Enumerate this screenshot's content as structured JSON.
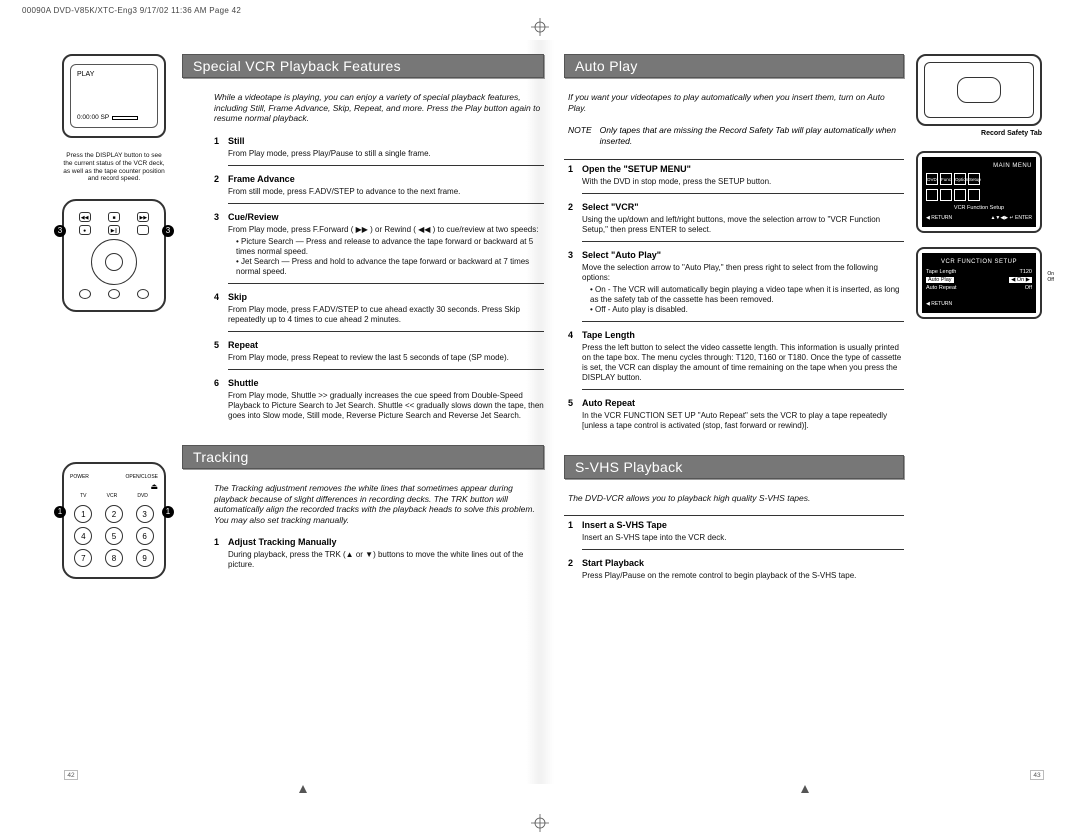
{
  "header_line": "00090A DVD-V85K/XTC-Eng3  9/17/02 11:36 AM  Page 42",
  "page_numbers": {
    "left": "42",
    "right": "43"
  },
  "left_page": {
    "sections": [
      {
        "title": "Special VCR Playback Features",
        "intro": "While a videotape is playing, you can enjoy a variety of special playback features, including Still, Frame Advance, Skip, Repeat, and more. Press the Play button again to resume normal playback.",
        "sidebar": {
          "tv_play_label": "PLAY",
          "tv_counter": "0:00:00 SP",
          "tv_caption": "Press the DISPLAY button to see the current status of the VCR deck, as well as the tape counter position and record speed."
        },
        "steps": [
          {
            "n": "1",
            "title": "Still",
            "text": "From Play mode, press Play/Pause to still a single frame."
          },
          {
            "n": "2",
            "title": "Frame Advance",
            "text": "From still mode, press F.ADV/STEP to advance to the next frame."
          },
          {
            "n": "3",
            "title": "Cue/Review",
            "text": "From Play mode, press F.Forward ( ▶▶ ) or Rewind ( ◀◀ ) to cue/review at two speeds:",
            "bullets": [
              "Picture Search — Press and release to advance the tape forward or backward at 5 times normal speed.",
              "Jet Search — Press and hold to advance the tape forward or backward at 7 times normal speed."
            ]
          },
          {
            "n": "4",
            "title": "Skip",
            "text": "From Play mode, press F.ADV/STEP to cue ahead exactly 30 seconds. Press Skip repeatedly up to 4 times to cue ahead 2 minutes."
          },
          {
            "n": "5",
            "title": "Repeat",
            "text": "From Play mode, press Repeat to review the last 5 seconds of tape (SP mode)."
          },
          {
            "n": "6",
            "title": "Shuttle",
            "text": "From Play mode, Shuttle >> gradually increases the cue speed from Double-Speed Playback to Picture Search to Jet Search. Shuttle << gradually slows down the tape, then goes into Slow mode, Still mode, Reverse Picture Search and Reverse Jet Search."
          }
        ]
      },
      {
        "title": "Tracking",
        "intro": "The Tracking adjustment removes the white lines that sometimes appear during playback because of slight differences in recording decks. The TRK button will automatically align the recorded tracks with the playback heads to solve this problem. You may also set tracking manually.",
        "steps": [
          {
            "n": "1",
            "title": "Adjust Tracking Manually",
            "text": "During playback, press the TRK (▲ or ▼) buttons to move the white lines out of the picture."
          }
        ]
      }
    ]
  },
  "right_page": {
    "sections": [
      {
        "title": "Auto Play",
        "intro": "If you want your videotapes to play automatically when you insert them, turn on Auto Play.",
        "note_label": "NOTE",
        "note_text": "Only tapes that are missing the Record Safety Tab will play automatically when inserted.",
        "sidebar": {
          "cassette_caption": "Record Safety Tab",
          "osd1": {
            "title": "MAIN MENU",
            "row_icons": [
              "DVD",
              "Func",
              "Option",
              "Setup"
            ],
            "mid": "VCR Function Setup",
            "foot_left": "◀ RETURN",
            "foot_right": "▲▼◀▶  ↵ ENTER"
          },
          "osd2": {
            "title": "VCR FUNCTION SETUP",
            "rows": [
              {
                "k": "Tape Length",
                "v": "T120"
              },
              {
                "k": "Auto Play",
                "v": "◀ On ▶",
                "hl": true
              },
              {
                "k": "Auto Repeat",
                "v": "Off"
              }
            ],
            "side_opts": [
              "On",
              "Off"
            ],
            "foot_left": "◀ RETURN"
          }
        },
        "steps": [
          {
            "n": "1",
            "title": "Open the \"SETUP MENU\"",
            "text": "With the DVD in stop mode, press the SETUP button."
          },
          {
            "n": "2",
            "title": "Select \"VCR\"",
            "text": "Using the up/down and left/right buttons, move the selection arrow to \"VCR Function Setup,\" then press ENTER to select."
          },
          {
            "n": "3",
            "title": "Select \"Auto Play\"",
            "text": "Move the selection arrow to \"Auto Play,\" then press right to select from the following options:",
            "bullets": [
              "On - The VCR will automatically begin playing a video tape when it is inserted, as long as the safety tab of the cassette has been removed.",
              "Off - Auto play is disabled."
            ]
          },
          {
            "n": "4",
            "title": "Tape Length",
            "text": "Press the left button to select the video cassette length. This information is usually printed on the tape box. The menu cycles through: T120, T160 or T180. Once the type of cassette is set, the VCR can display the amount of time remaining on the tape when you press the DISPLAY button."
          },
          {
            "n": "5",
            "title": "Auto Repeat",
            "text": "In the VCR FUNCTION SET UP \"Auto Repeat\" sets the VCR to play a tape repeatedly [unless a tape control is activated (stop, fast forward or rewind)]."
          }
        ]
      },
      {
        "title": "S-VHS Playback",
        "intro": "The DVD-VCR allows you to playback high quality S-VHS tapes.",
        "steps": [
          {
            "n": "1",
            "title": "Insert a S-VHS Tape",
            "text": "Insert an S-VHS tape into the VCR deck."
          },
          {
            "n": "2",
            "title": "Start Playback",
            "text": "Press Play/Pause on the remote control to begin playback of the S-VHS tape."
          }
        ]
      }
    ]
  }
}
